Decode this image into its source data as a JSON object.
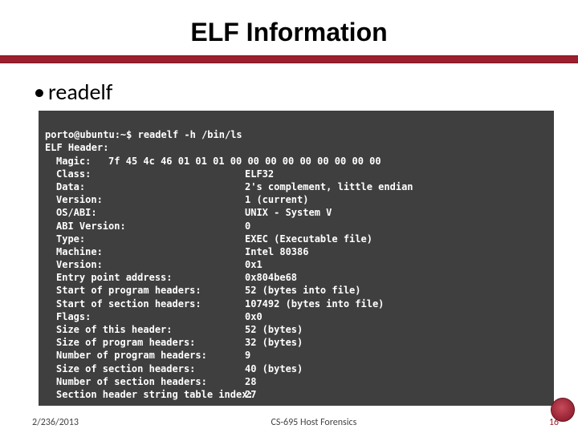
{
  "title": "ELF Information",
  "bullet": "readelf",
  "terminal": {
    "prompt": "porto@ubuntu:~$",
    "command": "readelf -h /bin/ls",
    "header_line": "ELF Header:",
    "magic_label": "Magic:",
    "magic_value": "7f 45 4c 46 01 01 01 00 00 00 00 00 00 00 00 00",
    "rows": [
      {
        "k": "Class:",
        "v": "ELF32"
      },
      {
        "k": "Data:",
        "v": "2's complement, little endian"
      },
      {
        "k": "Version:",
        "v": "1 (current)"
      },
      {
        "k": "OS/ABI:",
        "v": "UNIX - System V"
      },
      {
        "k": "ABI Version:",
        "v": "0"
      },
      {
        "k": "Type:",
        "v": "EXEC (Executable file)"
      },
      {
        "k": "Machine:",
        "v": "Intel 80386"
      },
      {
        "k": "Version:",
        "v": "0x1"
      },
      {
        "k": "Entry point address:",
        "v": "0x804be68"
      },
      {
        "k": "Start of program headers:",
        "v": "52 (bytes into file)"
      },
      {
        "k": "Start of section headers:",
        "v": "107492 (bytes into file)"
      },
      {
        "k": "Flags:",
        "v": "0x0"
      },
      {
        "k": "Size of this header:",
        "v": "52 (bytes)"
      },
      {
        "k": "Size of program headers:",
        "v": "32 (bytes)"
      },
      {
        "k": "Number of program headers:",
        "v": "9"
      },
      {
        "k": "Size of section headers:",
        "v": "40 (bytes)"
      },
      {
        "k": "Number of section headers:",
        "v": "28"
      },
      {
        "k": "Section header string table index:",
        "v": "27"
      }
    ]
  },
  "footer": {
    "date": "2/236/2013",
    "course": "CS-695 Host Forensics",
    "page": "16"
  }
}
